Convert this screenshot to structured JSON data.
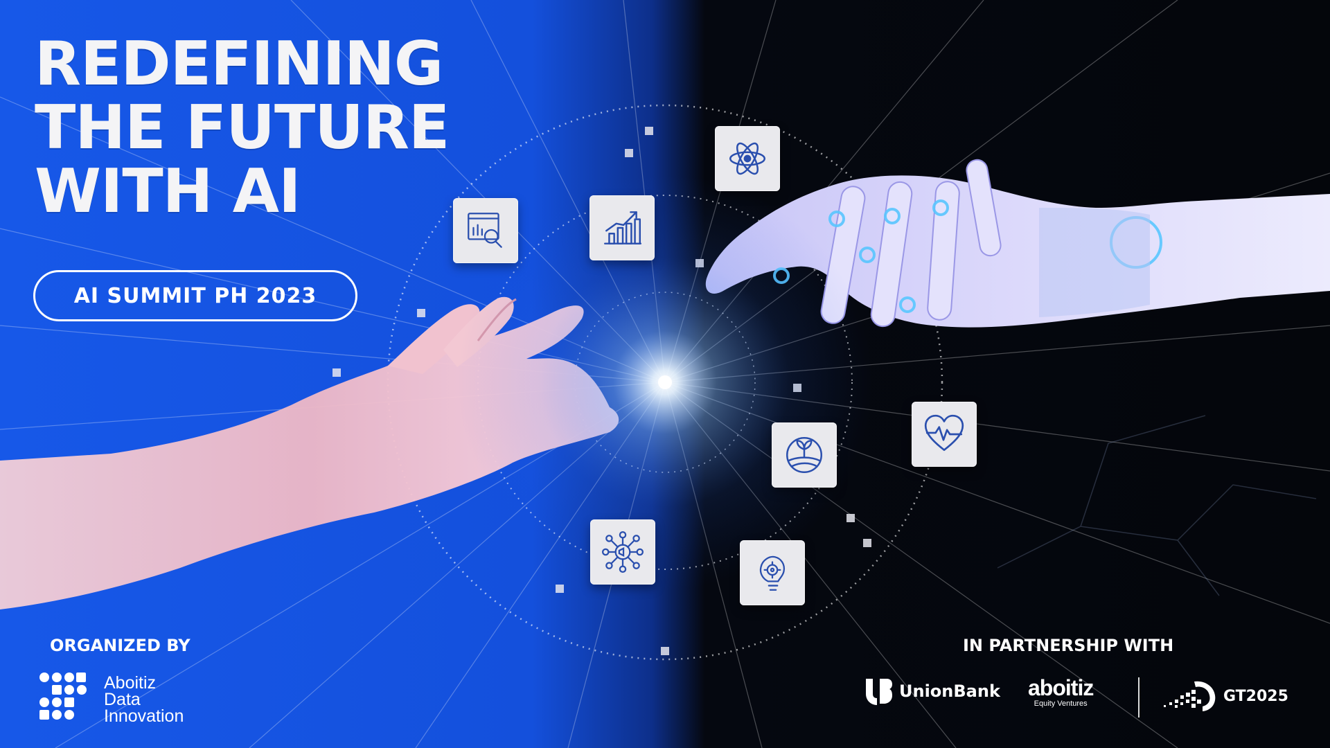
{
  "headline": {
    "line1": "REDEFINING",
    "line2": "THE FUTURE",
    "line3": "WITH AI"
  },
  "event_badge": "AI SUMMIT PH 2023",
  "organized_by": {
    "label": "ORGANIZED BY",
    "logo_line1": "Aboitiz",
    "logo_line2": "Data",
    "logo_line3": "Innovation"
  },
  "partnership": {
    "label": "IN PARTNERSHIP WITH",
    "partners": [
      {
        "name": "UnionBank",
        "icon": "unionbank-logo"
      },
      {
        "name": "aboitiz",
        "subtitle": "Equity Ventures",
        "icon": "aboitiz-logo"
      },
      {
        "name": "GT2025",
        "icon": "gt2025-logo"
      }
    ]
  },
  "icon_tiles": [
    {
      "icon": "data-analytics-icon"
    },
    {
      "icon": "growth-chart-icon"
    },
    {
      "icon": "atom-icon"
    },
    {
      "icon": "agriculture-icon"
    },
    {
      "icon": "heart-health-icon"
    },
    {
      "icon": "network-megaphone-icon"
    },
    {
      "icon": "idea-gear-icon"
    }
  ],
  "colors": {
    "left_background": "#1457e6",
    "right_background": "#05070d",
    "text": "#ffffff",
    "icon_stroke": "#2a4fae",
    "tile": "#e9e9ed"
  }
}
